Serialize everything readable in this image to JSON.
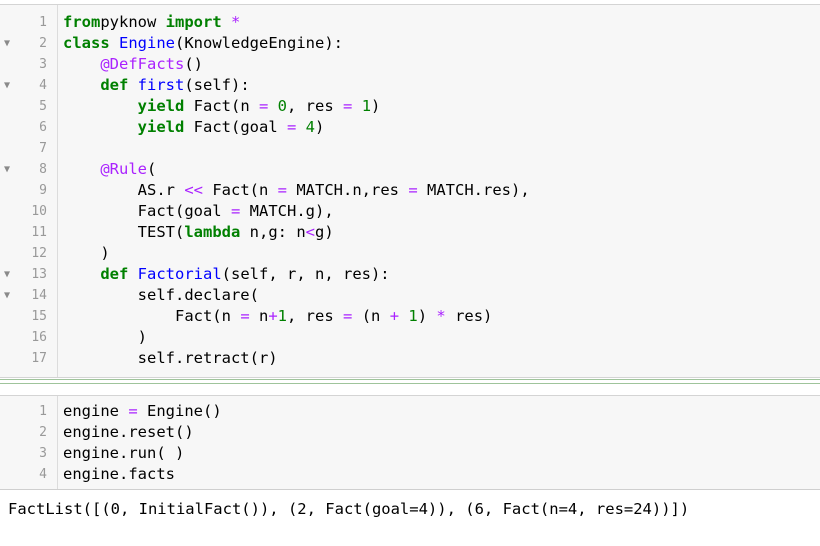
{
  "cell1": {
    "lines": [
      {
        "n": "1",
        "fold": "",
        "segs": [
          [
            "kw",
            "from"
          ],
          [
            "",
            "pyknow "
          ],
          [
            "kw",
            "import"
          ],
          [
            "",
            " "
          ],
          [
            "op",
            "*"
          ]
        ]
      },
      {
        "n": "2",
        "fold": "▼",
        "segs": [
          [
            "kw",
            "class"
          ],
          [
            "",
            " "
          ],
          [
            "cls",
            "Engine"
          ],
          [
            "",
            "(KnowledgeEngine):"
          ]
        ]
      },
      {
        "n": "3",
        "fold": "",
        "segs": [
          [
            "",
            "    "
          ],
          [
            "dec",
            "@DefFacts"
          ],
          [
            "",
            "()"
          ]
        ]
      },
      {
        "n": "4",
        "fold": "▼",
        "segs": [
          [
            "",
            "    "
          ],
          [
            "kw",
            "def"
          ],
          [
            "",
            " "
          ],
          [
            "fn",
            "first"
          ],
          [
            "",
            "(self):"
          ]
        ]
      },
      {
        "n": "5",
        "fold": "",
        "segs": [
          [
            "",
            "        "
          ],
          [
            "kw",
            "yield"
          ],
          [
            "",
            " Fact(n "
          ],
          [
            "op",
            "="
          ],
          [
            "",
            " "
          ],
          [
            "num",
            "0"
          ],
          [
            "",
            ", res "
          ],
          [
            "op",
            "="
          ],
          [
            "",
            " "
          ],
          [
            "num",
            "1"
          ],
          [
            "",
            ")"
          ]
        ]
      },
      {
        "n": "6",
        "fold": "",
        "segs": [
          [
            "",
            "        "
          ],
          [
            "kw",
            "yield"
          ],
          [
            "",
            " Fact(goal "
          ],
          [
            "op",
            "="
          ],
          [
            "",
            " "
          ],
          [
            "num",
            "4"
          ],
          [
            "",
            ")"
          ]
        ]
      },
      {
        "n": "7",
        "fold": "",
        "segs": []
      },
      {
        "n": "8",
        "fold": "▼",
        "segs": [
          [
            "",
            "    "
          ],
          [
            "dec",
            "@Rule"
          ],
          [
            "",
            "("
          ]
        ]
      },
      {
        "n": "9",
        "fold": "",
        "segs": [
          [
            "",
            "        AS.r "
          ],
          [
            "op",
            "<<"
          ],
          [
            "",
            " Fact(n "
          ],
          [
            "op",
            "="
          ],
          [
            "",
            " MATCH.n,res "
          ],
          [
            "op",
            "="
          ],
          [
            "",
            " MATCH.res),"
          ]
        ]
      },
      {
        "n": "10",
        "fold": "",
        "segs": [
          [
            "",
            "        Fact(goal "
          ],
          [
            "op",
            "="
          ],
          [
            "",
            " MATCH.g),"
          ]
        ]
      },
      {
        "n": "11",
        "fold": "",
        "segs": [
          [
            "",
            "        TEST("
          ],
          [
            "kw",
            "lambda"
          ],
          [
            "",
            " n,g: n"
          ],
          [
            "op",
            "<"
          ],
          [
            "",
            "g)"
          ]
        ]
      },
      {
        "n": "12",
        "fold": "",
        "segs": [
          [
            "",
            "    )"
          ]
        ]
      },
      {
        "n": "13",
        "fold": "▼",
        "segs": [
          [
            "",
            "    "
          ],
          [
            "kw",
            "def"
          ],
          [
            "",
            " "
          ],
          [
            "fn",
            "Factorial"
          ],
          [
            "",
            "(self, r, n, res):"
          ]
        ]
      },
      {
        "n": "14",
        "fold": "▼",
        "segs": [
          [
            "",
            "        self.declare("
          ]
        ]
      },
      {
        "n": "15",
        "fold": "",
        "segs": [
          [
            "",
            "            Fact(n "
          ],
          [
            "op",
            "="
          ],
          [
            "",
            " n"
          ],
          [
            "op",
            "+"
          ],
          [
            "num",
            "1"
          ],
          [
            "",
            ", res "
          ],
          [
            "op",
            "="
          ],
          [
            "",
            " (n "
          ],
          [
            "op",
            "+"
          ],
          [
            "",
            " "
          ],
          [
            "num",
            "1"
          ],
          [
            "",
            ") "
          ],
          [
            "op",
            "*"
          ],
          [
            "",
            " res)"
          ]
        ]
      },
      {
        "n": "16",
        "fold": "",
        "segs": [
          [
            "",
            "        )"
          ]
        ]
      },
      {
        "n": "17",
        "fold": "",
        "segs": [
          [
            "",
            "        self.retract(r)"
          ]
        ]
      }
    ]
  },
  "cell2": {
    "lines": [
      {
        "n": "1",
        "fold": "",
        "segs": [
          [
            "",
            "engine "
          ],
          [
            "op",
            "="
          ],
          [
            "",
            " Engine()"
          ]
        ]
      },
      {
        "n": "2",
        "fold": "",
        "segs": [
          [
            "",
            "engine.reset()"
          ]
        ]
      },
      {
        "n": "3",
        "fold": "",
        "segs": [
          [
            "",
            "engine.run( )"
          ]
        ]
      },
      {
        "n": "4",
        "fold": "",
        "segs": [
          [
            "",
            "engine.facts"
          ]
        ]
      }
    ]
  },
  "output": {
    "text": "FactList([(0, InitialFact()), (2, Fact(goal=4)), (6, Fact(n=4, res=24))])"
  }
}
